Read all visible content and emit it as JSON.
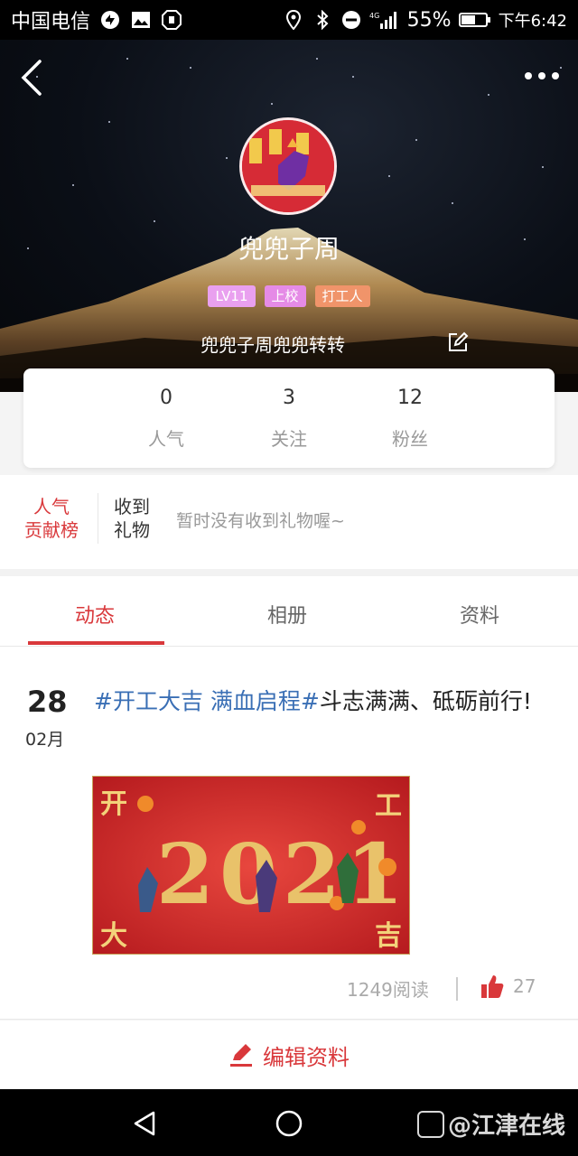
{
  "status_bar": {
    "carrier": "中国电信",
    "network": "4G",
    "battery": "55%",
    "time": "下午6:42"
  },
  "profile": {
    "nickname": "兜兜子周",
    "badges": [
      "LV11",
      "上校",
      "打工人"
    ],
    "signature": "兜兜子周兜兜转转"
  },
  "stats": [
    {
      "value": "0",
      "label": "人气"
    },
    {
      "value": "3",
      "label": "关注"
    },
    {
      "value": "12",
      "label": "粉丝"
    }
  ],
  "gifts": {
    "rank_label_line1": "人气",
    "rank_label_line2": "贡献榜",
    "title_line1": "收到",
    "title_line2": "礼物",
    "empty_text": "暂时没有收到礼物喔~"
  },
  "tabs": [
    {
      "label": "动态",
      "active": true
    },
    {
      "label": "相册",
      "active": false
    },
    {
      "label": "资料",
      "active": false
    }
  ],
  "post": {
    "day": "28",
    "month": "02月",
    "tag": "#开工大吉 满血启程#",
    "text": "斗志满满、砥砺前行!",
    "image_text": {
      "year": "2021",
      "corner_top_left": "开",
      "corner_top_right": "工",
      "corner_bottom_left": "大",
      "corner_bottom_right": "吉"
    },
    "reads": "1249阅读",
    "likes": "27"
  },
  "edit_profile_label": "编辑资料",
  "watermark": "@江津在线",
  "colors": {
    "accent": "#d9383b",
    "tag_link": "#3a6fb5",
    "badge_lv": "#e9a0ef",
    "badge_rank": "#e58be6",
    "badge_worker": "#f0946a"
  }
}
